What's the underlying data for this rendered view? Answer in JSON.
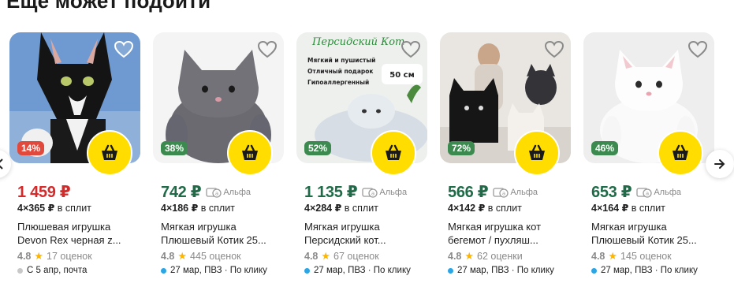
{
  "section": {
    "title": "Еще может подойти"
  },
  "colors": {
    "accent_yellow": "#ffdd00",
    "price_red": "#d62a2a",
    "price_green": "#1f6b48",
    "discount_red": "#e0493c",
    "discount_green": "#3c8a4f",
    "dot_blue": "#2aa5e6",
    "dot_gray": "#c8c8c8"
  },
  "products": [
    {
      "discount": "14%",
      "price": "1 459 ₽",
      "alfa": "",
      "split": {
        "amount": "4×365 ₽",
        "label": "в сплит"
      },
      "name_line1": "Плюшевая игрушка",
      "name_line2": "Devon Rex черная z...",
      "rating": "4.8",
      "reviews": "17 оценок",
      "delivery": "С 5 апр, почта"
    },
    {
      "discount": "38%",
      "price": "742 ₽",
      "alfa": "Альфа",
      "split": {
        "amount": "4×186 ₽",
        "label": "в сплит"
      },
      "name_line1": "Мягкая игрушка",
      "name_line2": "Плюшевый Котик 25...",
      "rating": "4.8",
      "reviews": "445 оценок",
      "delivery": "27 мар, ПВЗ · По клику"
    },
    {
      "discount": "52%",
      "price": "1 135 ₽",
      "alfa": "Альфа",
      "split": {
        "amount": "4×284 ₽",
        "label": "в сплит"
      },
      "name_line1": "Мягкая игрушка",
      "name_line2": "Персидский кот...",
      "rating": "4.8",
      "reviews": "67 оценок",
      "delivery": "27 мар, ПВЗ · По клику",
      "photo_text": {
        "title": "Персидский Кот",
        "l1": "Мягкий и пушистый",
        "l2": "Отличный подарок",
        "l3": "Гипоаллергенный",
        "size": "50 см"
      }
    },
    {
      "discount": "72%",
      "price": "566 ₽",
      "alfa": "Альфа",
      "split": {
        "amount": "4×142 ₽",
        "label": "в сплит"
      },
      "name_line1": "Мягкая игрушка кот",
      "name_line2": "бегемот / пухляш...",
      "rating": "4.8",
      "reviews": "62 оценки",
      "delivery": "27 мар, ПВЗ · По клику"
    },
    {
      "discount": "46%",
      "price": "653 ₽",
      "alfa": "Альфа",
      "split": {
        "amount": "4×164 ₽",
        "label": "в сплит"
      },
      "name_line1": "Мягкая игрушка",
      "name_line2": "Плюшевый Котик 25...",
      "rating": "4.8",
      "reviews": "145 оценок",
      "delivery": "27 мар, ПВЗ · По клику"
    }
  ]
}
